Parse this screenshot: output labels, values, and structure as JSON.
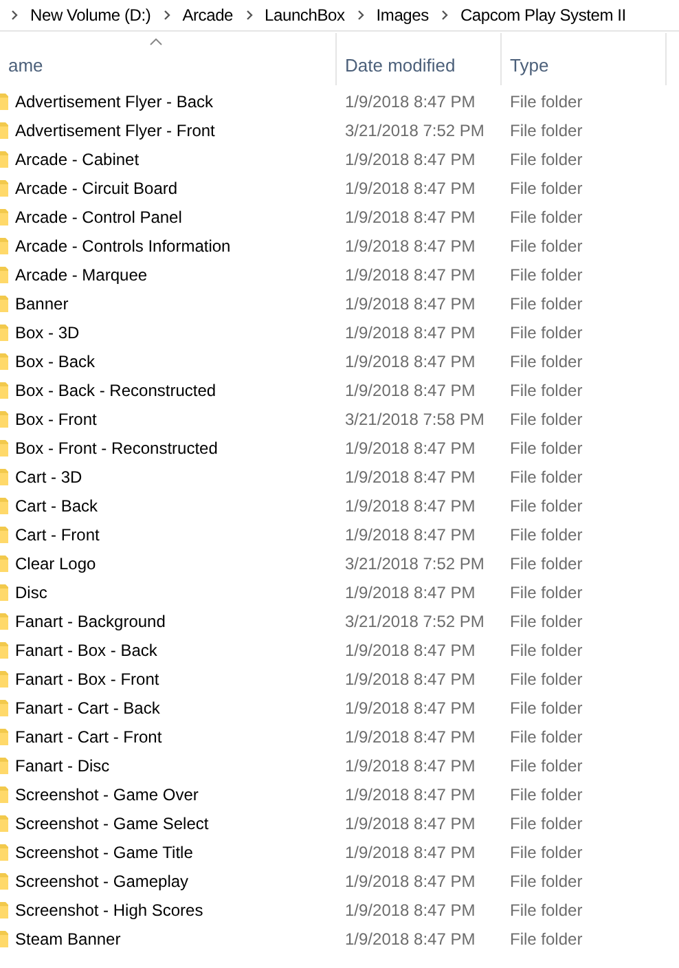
{
  "breadcrumb": [
    "New Volume (D:)",
    "Arcade",
    "LaunchBox",
    "Images",
    "Capcom Play System II"
  ],
  "columns": [
    {
      "label": "ame",
      "sorted": true
    },
    {
      "label": "Date modified",
      "sorted": false
    },
    {
      "label": "Type",
      "sorted": false
    }
  ],
  "rows": [
    {
      "name": "Advertisement Flyer - Back",
      "date": "1/9/2018 8:47 PM",
      "type": "File folder"
    },
    {
      "name": "Advertisement Flyer - Front",
      "date": "3/21/2018 7:52 PM",
      "type": "File folder"
    },
    {
      "name": "Arcade - Cabinet",
      "date": "1/9/2018 8:47 PM",
      "type": "File folder"
    },
    {
      "name": "Arcade - Circuit Board",
      "date": "1/9/2018 8:47 PM",
      "type": "File folder"
    },
    {
      "name": "Arcade - Control Panel",
      "date": "1/9/2018 8:47 PM",
      "type": "File folder"
    },
    {
      "name": "Arcade - Controls Information",
      "date": "1/9/2018 8:47 PM",
      "type": "File folder"
    },
    {
      "name": "Arcade - Marquee",
      "date": "1/9/2018 8:47 PM",
      "type": "File folder"
    },
    {
      "name": "Banner",
      "date": "1/9/2018 8:47 PM",
      "type": "File folder"
    },
    {
      "name": "Box - 3D",
      "date": "1/9/2018 8:47 PM",
      "type": "File folder"
    },
    {
      "name": "Box - Back",
      "date": "1/9/2018 8:47 PM",
      "type": "File folder"
    },
    {
      "name": "Box - Back - Reconstructed",
      "date": "1/9/2018 8:47 PM",
      "type": "File folder"
    },
    {
      "name": "Box - Front",
      "date": "3/21/2018 7:58 PM",
      "type": "File folder"
    },
    {
      "name": "Box - Front - Reconstructed",
      "date": "1/9/2018 8:47 PM",
      "type": "File folder"
    },
    {
      "name": "Cart - 3D",
      "date": "1/9/2018 8:47 PM",
      "type": "File folder"
    },
    {
      "name": "Cart - Back",
      "date": "1/9/2018 8:47 PM",
      "type": "File folder"
    },
    {
      "name": "Cart - Front",
      "date": "1/9/2018 8:47 PM",
      "type": "File folder"
    },
    {
      "name": "Clear Logo",
      "date": "3/21/2018 7:52 PM",
      "type": "File folder"
    },
    {
      "name": "Disc",
      "date": "1/9/2018 8:47 PM",
      "type": "File folder"
    },
    {
      "name": "Fanart - Background",
      "date": "3/21/2018 7:52 PM",
      "type": "File folder"
    },
    {
      "name": "Fanart - Box - Back",
      "date": "1/9/2018 8:47 PM",
      "type": "File folder"
    },
    {
      "name": "Fanart - Box - Front",
      "date": "1/9/2018 8:47 PM",
      "type": "File folder"
    },
    {
      "name": "Fanart - Cart - Back",
      "date": "1/9/2018 8:47 PM",
      "type": "File folder"
    },
    {
      "name": "Fanart - Cart - Front",
      "date": "1/9/2018 8:47 PM",
      "type": "File folder"
    },
    {
      "name": "Fanart - Disc",
      "date": "1/9/2018 8:47 PM",
      "type": "File folder"
    },
    {
      "name": "Screenshot - Game Over",
      "date": "1/9/2018 8:47 PM",
      "type": "File folder"
    },
    {
      "name": "Screenshot - Game Select",
      "date": "1/9/2018 8:47 PM",
      "type": "File folder"
    },
    {
      "name": "Screenshot - Game Title",
      "date": "1/9/2018 8:47 PM",
      "type": "File folder"
    },
    {
      "name": "Screenshot - Gameplay",
      "date": "1/9/2018 8:47 PM",
      "type": "File folder"
    },
    {
      "name": "Screenshot - High Scores",
      "date": "1/9/2018 8:47 PM",
      "type": "File folder"
    },
    {
      "name": "Steam Banner",
      "date": "1/9/2018 8:47 PM",
      "type": "File folder"
    }
  ]
}
